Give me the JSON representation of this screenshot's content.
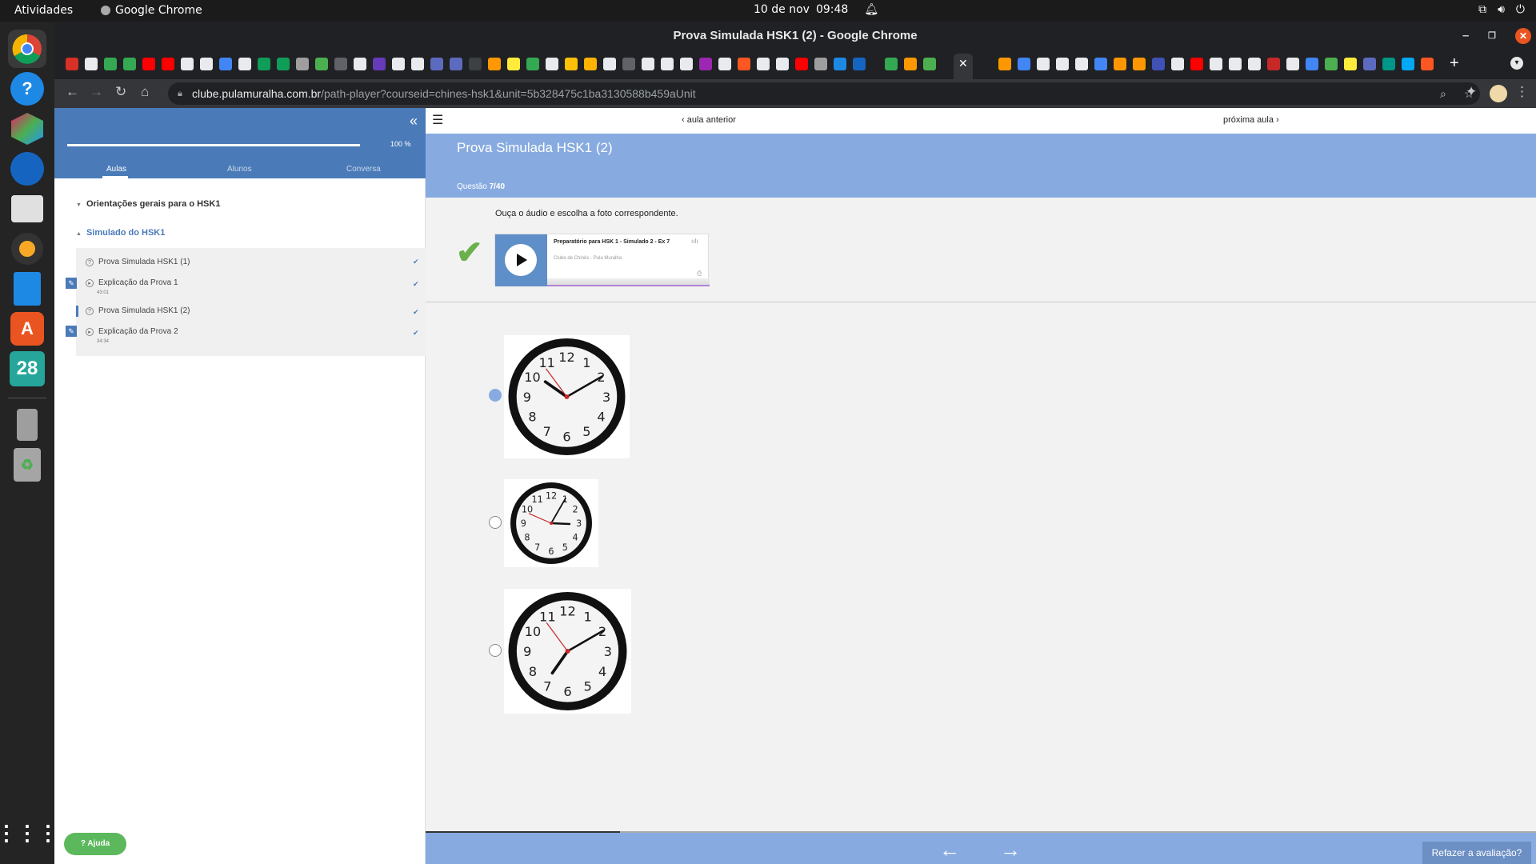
{
  "system": {
    "activities": "Atividades",
    "app_name": "Google Chrome",
    "date": "10 de nov",
    "time": "09:48"
  },
  "dock": {
    "calendar_day": "28"
  },
  "browser": {
    "window_title": "Prova Simulada HSK1 (2) - Google Chrome",
    "url_host": "clube.pulamuralha.com.br",
    "url_path": "/path-player?courseid=chines-hsk1&unit=5b328475c1ba3130588b459aUnit"
  },
  "sidebar": {
    "progress_percent": "100 %",
    "progress_value": 1.0,
    "tabs": [
      "Aulas",
      "Alunos",
      "Conversa"
    ],
    "sections": [
      {
        "title": "Orientações gerais para o HSK1"
      },
      {
        "title": "Simulado do HSK1"
      }
    ],
    "lessons": [
      {
        "title": "Prova Simulada HSK1 (1)",
        "duration": ""
      },
      {
        "title": "Explicação da Prova 1",
        "duration": "43:01"
      },
      {
        "title": "Prova Simulada HSK1 (2)",
        "duration": ""
      },
      {
        "title": "Explicação da Prova 2",
        "duration": "34:34"
      }
    ],
    "help_label": "Ajuda"
  },
  "main": {
    "prev_lesson": "aula anterior",
    "next_lesson": "próxima aula",
    "title": "Prova Simulada HSK1 (2)",
    "question_label": "Questão",
    "question_num": "7/40",
    "instruction": "Ouça o áudio e escolha a foto correspondente.",
    "player": {
      "track_title": "Preparatório para HSK 1 - Simulado 2 - Ex 7",
      "artist": "Clube de Chinês - Pula Muralha"
    },
    "options": [
      {
        "hour": 10,
        "minute": 10,
        "selected": true
      },
      {
        "hour": 3,
        "minute": 5,
        "selected": false
      },
      {
        "hour": 7,
        "minute": 10,
        "selected": false
      }
    ],
    "redo_button": "Refazer a avaliação?"
  },
  "colors": {
    "header_blue": "#87abe0",
    "sidebar_blue": "#4a7bb8",
    "check_green": "#6ab04c",
    "help_green": "#5cb85c"
  }
}
